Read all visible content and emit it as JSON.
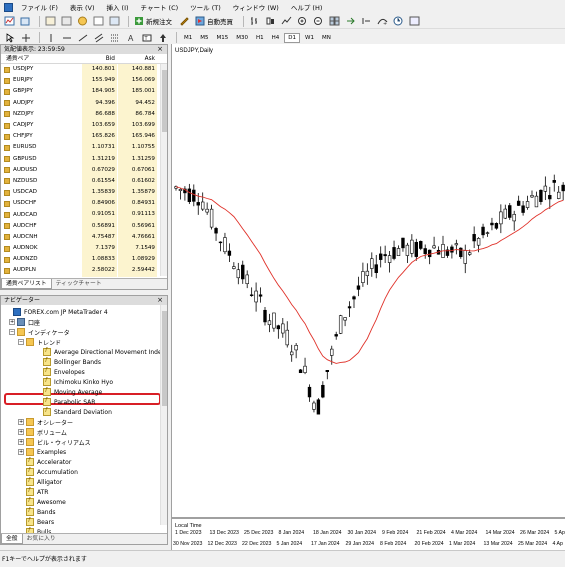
{
  "menu": [
    "ファイル (F)",
    "表示 (V)",
    "挿入 (I)",
    "チャート (C)",
    "ツール (T)",
    "ウィンドウ (W)",
    "ヘルプ (H)"
  ],
  "toolbar": {
    "new_order": "新規注文",
    "auto_trade": "自動売買",
    "timeframes": [
      "M1",
      "M5",
      "M15",
      "M30",
      "H1",
      "H4",
      "D1",
      "W1",
      "MN"
    ],
    "active_timeframe": "D1"
  },
  "market_watch": {
    "title": "気配値表示: 23:59:59",
    "col_symbol": "通貨ペア",
    "col_bid": "Bid",
    "col_ask": "Ask",
    "rows": [
      {
        "sym": "USDJPY",
        "bid": "140.801",
        "ask": "140.881",
        "dot": "#e3b23c"
      },
      {
        "sym": "EURJPY",
        "bid": "155.949",
        "ask": "156.069",
        "dot": "#e3b23c"
      },
      {
        "sym": "GBPJPY",
        "bid": "184.905",
        "ask": "185.001",
        "dot": "#e3b23c"
      },
      {
        "sym": "AUDJPY",
        "bid": "94.396",
        "ask": "94.452",
        "dot": "#e3b23c"
      },
      {
        "sym": "NZDJPY",
        "bid": "86.688",
        "ask": "86.784",
        "dot": "#e3b23c"
      },
      {
        "sym": "CADJPY",
        "bid": "103.659",
        "ask": "103.699",
        "dot": "#e3b23c"
      },
      {
        "sym": "CHFJPY",
        "bid": "165.826",
        "ask": "165.946",
        "dot": "#e3b23c"
      },
      {
        "sym": "EURUSD",
        "bid": "1.10731",
        "ask": "1.10755",
        "dot": "#e3b23c"
      },
      {
        "sym": "GBPUSD",
        "bid": "1.31219",
        "ask": "1.31259",
        "dot": "#e3b23c"
      },
      {
        "sym": "AUDUSD",
        "bid": "0.67029",
        "ask": "0.67061",
        "dot": "#e3b23c"
      },
      {
        "sym": "NZDUSD",
        "bid": "0.61554",
        "ask": "0.61602",
        "dot": "#e3b23c"
      },
      {
        "sym": "USDCAD",
        "bid": "1.35839",
        "ask": "1.35879",
        "dot": "#e3b23c"
      },
      {
        "sym": "USDCHF",
        "bid": "0.84906",
        "ask": "0.84931",
        "dot": "#e3b23c"
      },
      {
        "sym": "AUDCAD",
        "bid": "0.91051",
        "ask": "0.91113",
        "dot": "#e3b23c"
      },
      {
        "sym": "AUDCHF",
        "bid": "0.56891",
        "ask": "0.56961",
        "dot": "#e3b23c"
      },
      {
        "sym": "AUDCNH",
        "bid": "4.75487",
        "ask": "4.76661",
        "dot": "#e3b23c"
      },
      {
        "sym": "AUDNOK",
        "bid": "7.1379",
        "ask": "7.1549",
        "dot": "#e3b23c"
      },
      {
        "sym": "AUDNZD",
        "bid": "1.08833",
        "ask": "1.08929",
        "dot": "#e3b23c"
      },
      {
        "sym": "AUDPLN",
        "bid": "2.58022",
        "ask": "2.59442",
        "dot": "#e3b23c"
      }
    ],
    "tabs": [
      "通貨ペアリスト",
      "ティックチャート"
    ]
  },
  "navigator": {
    "title": "ナビゲーター",
    "items": [
      {
        "label": "FOREX.com JP MetaTrader 4",
        "icon": "mt",
        "indent": 0,
        "exp": ""
      },
      {
        "label": "口座",
        "icon": "acct",
        "indent": 1,
        "exp": "+"
      },
      {
        "label": "インディケータ",
        "icon": "folder",
        "indent": 1,
        "exp": "−"
      },
      {
        "label": "トレンド",
        "icon": "folder",
        "indent": 2,
        "exp": "−"
      },
      {
        "label": "Average Directional Movement Index",
        "icon": "ind",
        "indent": 3,
        "exp": ""
      },
      {
        "label": "Bollinger Bands",
        "icon": "ind",
        "indent": 3,
        "exp": ""
      },
      {
        "label": "Envelopes",
        "icon": "ind",
        "indent": 3,
        "exp": ""
      },
      {
        "label": "Ichimoku Kinko Hyo",
        "icon": "ind",
        "indent": 3,
        "exp": ""
      },
      {
        "label": "Moving Average",
        "icon": "ind",
        "indent": 3,
        "exp": ""
      },
      {
        "label": "Parabolic SAR",
        "icon": "ind",
        "indent": 3,
        "exp": ""
      },
      {
        "label": "Standard Deviation",
        "icon": "ind",
        "indent": 3,
        "exp": ""
      },
      {
        "label": "オシレーター",
        "icon": "folder",
        "indent": 2,
        "exp": "+"
      },
      {
        "label": "ボリューム",
        "icon": "folder",
        "indent": 2,
        "exp": "+"
      },
      {
        "label": "ビル・ウィリアムス",
        "icon": "folder",
        "indent": 2,
        "exp": "+"
      },
      {
        "label": "Examples",
        "icon": "folder",
        "indent": 2,
        "exp": "+"
      },
      {
        "label": "Accelerator",
        "icon": "ind",
        "indent": 2,
        "exp": ""
      },
      {
        "label": "Accumulation",
        "icon": "ind",
        "indent": 2,
        "exp": ""
      },
      {
        "label": "Alligator",
        "icon": "ind",
        "indent": 2,
        "exp": ""
      },
      {
        "label": "ATR",
        "icon": "ind",
        "indent": 2,
        "exp": ""
      },
      {
        "label": "Awesome",
        "icon": "ind",
        "indent": 2,
        "exp": ""
      },
      {
        "label": "Bands",
        "icon": "ind",
        "indent": 2,
        "exp": ""
      },
      {
        "label": "Bears",
        "icon": "ind",
        "indent": 2,
        "exp": ""
      },
      {
        "label": "Bulls",
        "icon": "ind",
        "indent": 2,
        "exp": ""
      }
    ],
    "tabs": [
      "全般",
      "お気に入り"
    ]
  },
  "chart": {
    "title": "USDJPY,Daily",
    "time_label": "Local Time",
    "date_row1": [
      "1 Dec 2023",
      "13 Dec 2023",
      "25 Dec 2023",
      "8 Jan 2024",
      "18 Jan 2024",
      "30 Jan 2024",
      "9 Feb 2024",
      "21 Feb 2024",
      "4 Mar 2024",
      "14 Mar 2024",
      "26 Mar 2024",
      "5 Ap"
    ],
    "date_row2": [
      "30 Nov 2023",
      "12 Dec 2023",
      "22 Dec 2023",
      "5 Jan 2024",
      "17 Jan 2024",
      "29 Jan 2024",
      "8 Feb 2024",
      "20 Feb 2024",
      "1 Mar 2024",
      "13 Mar 2024",
      "25 Mar 2024",
      "4 Ap"
    ]
  },
  "status": "F1キーでヘルプが表示されます",
  "colors": {
    "highlight": "#d81f26",
    "ma_line": "#e0322a",
    "bid_bg": "#fcf4cf"
  }
}
